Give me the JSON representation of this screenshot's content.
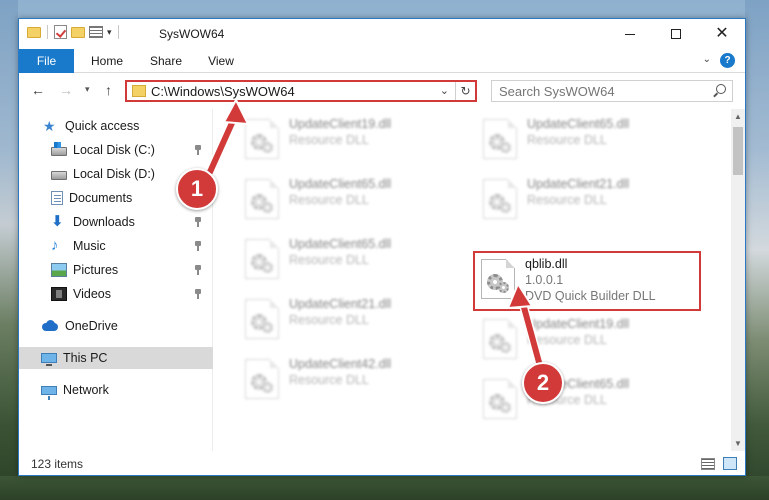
{
  "window": {
    "title": "SysWOW64",
    "minimize_label": "",
    "maximize_label": "",
    "close_label": "✕"
  },
  "ribbon": {
    "tabs": [
      "File",
      "Home",
      "Share",
      "View"
    ],
    "help_label": "?"
  },
  "address": {
    "path": "C:\\Windows\\SysWOW64",
    "search_placeholder": "Search SysWOW64"
  },
  "navpane": {
    "items": [
      {
        "label": "Quick access",
        "icon": "star-icon",
        "pinned": false
      },
      {
        "label": "Local Disk (C:)",
        "icon": "disk-icon",
        "pinned": true
      },
      {
        "label": "Local Disk (D:)",
        "icon": "disk-icon",
        "pinned": false
      },
      {
        "label": "Documents",
        "icon": "documents-icon",
        "pinned": true
      },
      {
        "label": "Downloads",
        "icon": "downloads-icon",
        "pinned": true
      },
      {
        "label": "Music",
        "icon": "music-icon",
        "pinned": true
      },
      {
        "label": "Pictures",
        "icon": "pictures-icon",
        "pinned": true
      },
      {
        "label": "Videos",
        "icon": "videos-icon",
        "pinned": true
      },
      {
        "label": "OneDrive",
        "icon": "cloud-icon",
        "pinned": false
      },
      {
        "label": "This PC",
        "icon": "computer-icon",
        "pinned": false,
        "selected": true
      },
      {
        "label": "Network",
        "icon": "network-icon",
        "pinned": false
      }
    ]
  },
  "files": [
    {
      "name": "UpdateClient19.dll",
      "line1": "Resource DLL",
      "line2": "",
      "blurred": true
    },
    {
      "name": "UpdateClient65.dll",
      "line1": "Resource DLL",
      "line2": "",
      "blurred": true
    },
    {
      "name": "UpdateClient65.dll",
      "line1": "Resource DLL",
      "line2": "",
      "blurred": true
    },
    {
      "name": "UpdateClient21.dll",
      "line1": "Resource DLL",
      "line2": "",
      "blurred": true
    },
    {
      "name": "UpdateClient65.dll",
      "line1": "Resource DLL",
      "line2": "",
      "blurred": true
    },
    {
      "name": "qblib.dll",
      "line1": "1.0.0.1",
      "line2": "DVD Quick Builder DLL",
      "blurred": false
    },
    {
      "name": "UpdateClient21.dll",
      "line1": "Resource DLL",
      "line2": "",
      "blurred": true
    },
    {
      "name": "UpdateClient19.dll",
      "line1": "Resource DLL",
      "line2": "",
      "blurred": true
    },
    {
      "name": "UpdateClient42.dll",
      "line1": "Resource DLL",
      "line2": "",
      "blurred": true
    },
    {
      "name": "UpdateClient65.dll",
      "line1": "Resource DLL",
      "line2": "",
      "blurred": true
    }
  ],
  "status": {
    "item_count": "123 items"
  },
  "annotations": {
    "step1": "1",
    "step2": "2",
    "color": "#d23a3a"
  },
  "colors": {
    "accent": "#1979ca",
    "highlight": "#d23a3a",
    "selection": "#cce8ff"
  }
}
